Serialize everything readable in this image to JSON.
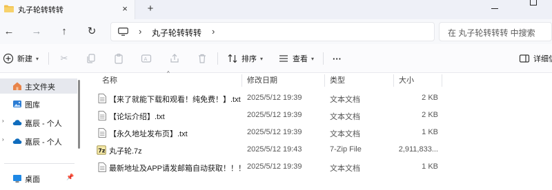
{
  "tab": {
    "title": "丸子轮转转转",
    "close_icon": "×"
  },
  "new_tab_label": "+",
  "nav": {
    "back_icon": "←",
    "forward_icon": "→",
    "up_icon": "↑",
    "refresh_icon": "↻",
    "separator_icon": "›",
    "breadcrumb": "丸子轮转转转"
  },
  "search": {
    "placeholder": "在 丸子轮转转转 中搜索"
  },
  "commands": {
    "new_label": "新建",
    "sort_label": "排序",
    "view_label": "查看",
    "more_label": "···",
    "details_label": "详细信"
  },
  "sidebar": {
    "items": [
      {
        "label": "主文件夹"
      },
      {
        "label": "图库"
      },
      {
        "label": "嘉辰 - 个人"
      },
      {
        "label": "嘉辰 - 个人"
      },
      {
        "label": "桌面"
      }
    ]
  },
  "columns": {
    "name": "名称",
    "date": "修改日期",
    "type": "类型",
    "size": "大小"
  },
  "files": [
    {
      "name": "【来了就能下载和观看！纯免费！】.txt",
      "date": "2025/5/12 19:39",
      "type": "文本文档",
      "size": "2 KB"
    },
    {
      "name": "【论坛介绍】.txt",
      "date": "2025/5/12 19:39",
      "type": "文本文档",
      "size": "2 KB"
    },
    {
      "name": "【永久地址发布页】.txt",
      "date": "2025/5/12 19:39",
      "type": "文本文档",
      "size": "1 KB"
    },
    {
      "name": "丸子轮.7z",
      "date": "2025/5/12 19:43",
      "type": "7-Zip File",
      "size": "2,911,833..."
    },
    {
      "name": "最新地址及APP请发邮箱自动获取！！！...",
      "date": "2025/5/12 19:39",
      "type": "文本文档",
      "size": "1 KB"
    }
  ],
  "colors": {
    "folder_yellow": "#f2c14e",
    "onedrive_blue": "#0f6cbd",
    "home_orange": "#e8844a",
    "selected_bg": "#e6e8ee"
  }
}
